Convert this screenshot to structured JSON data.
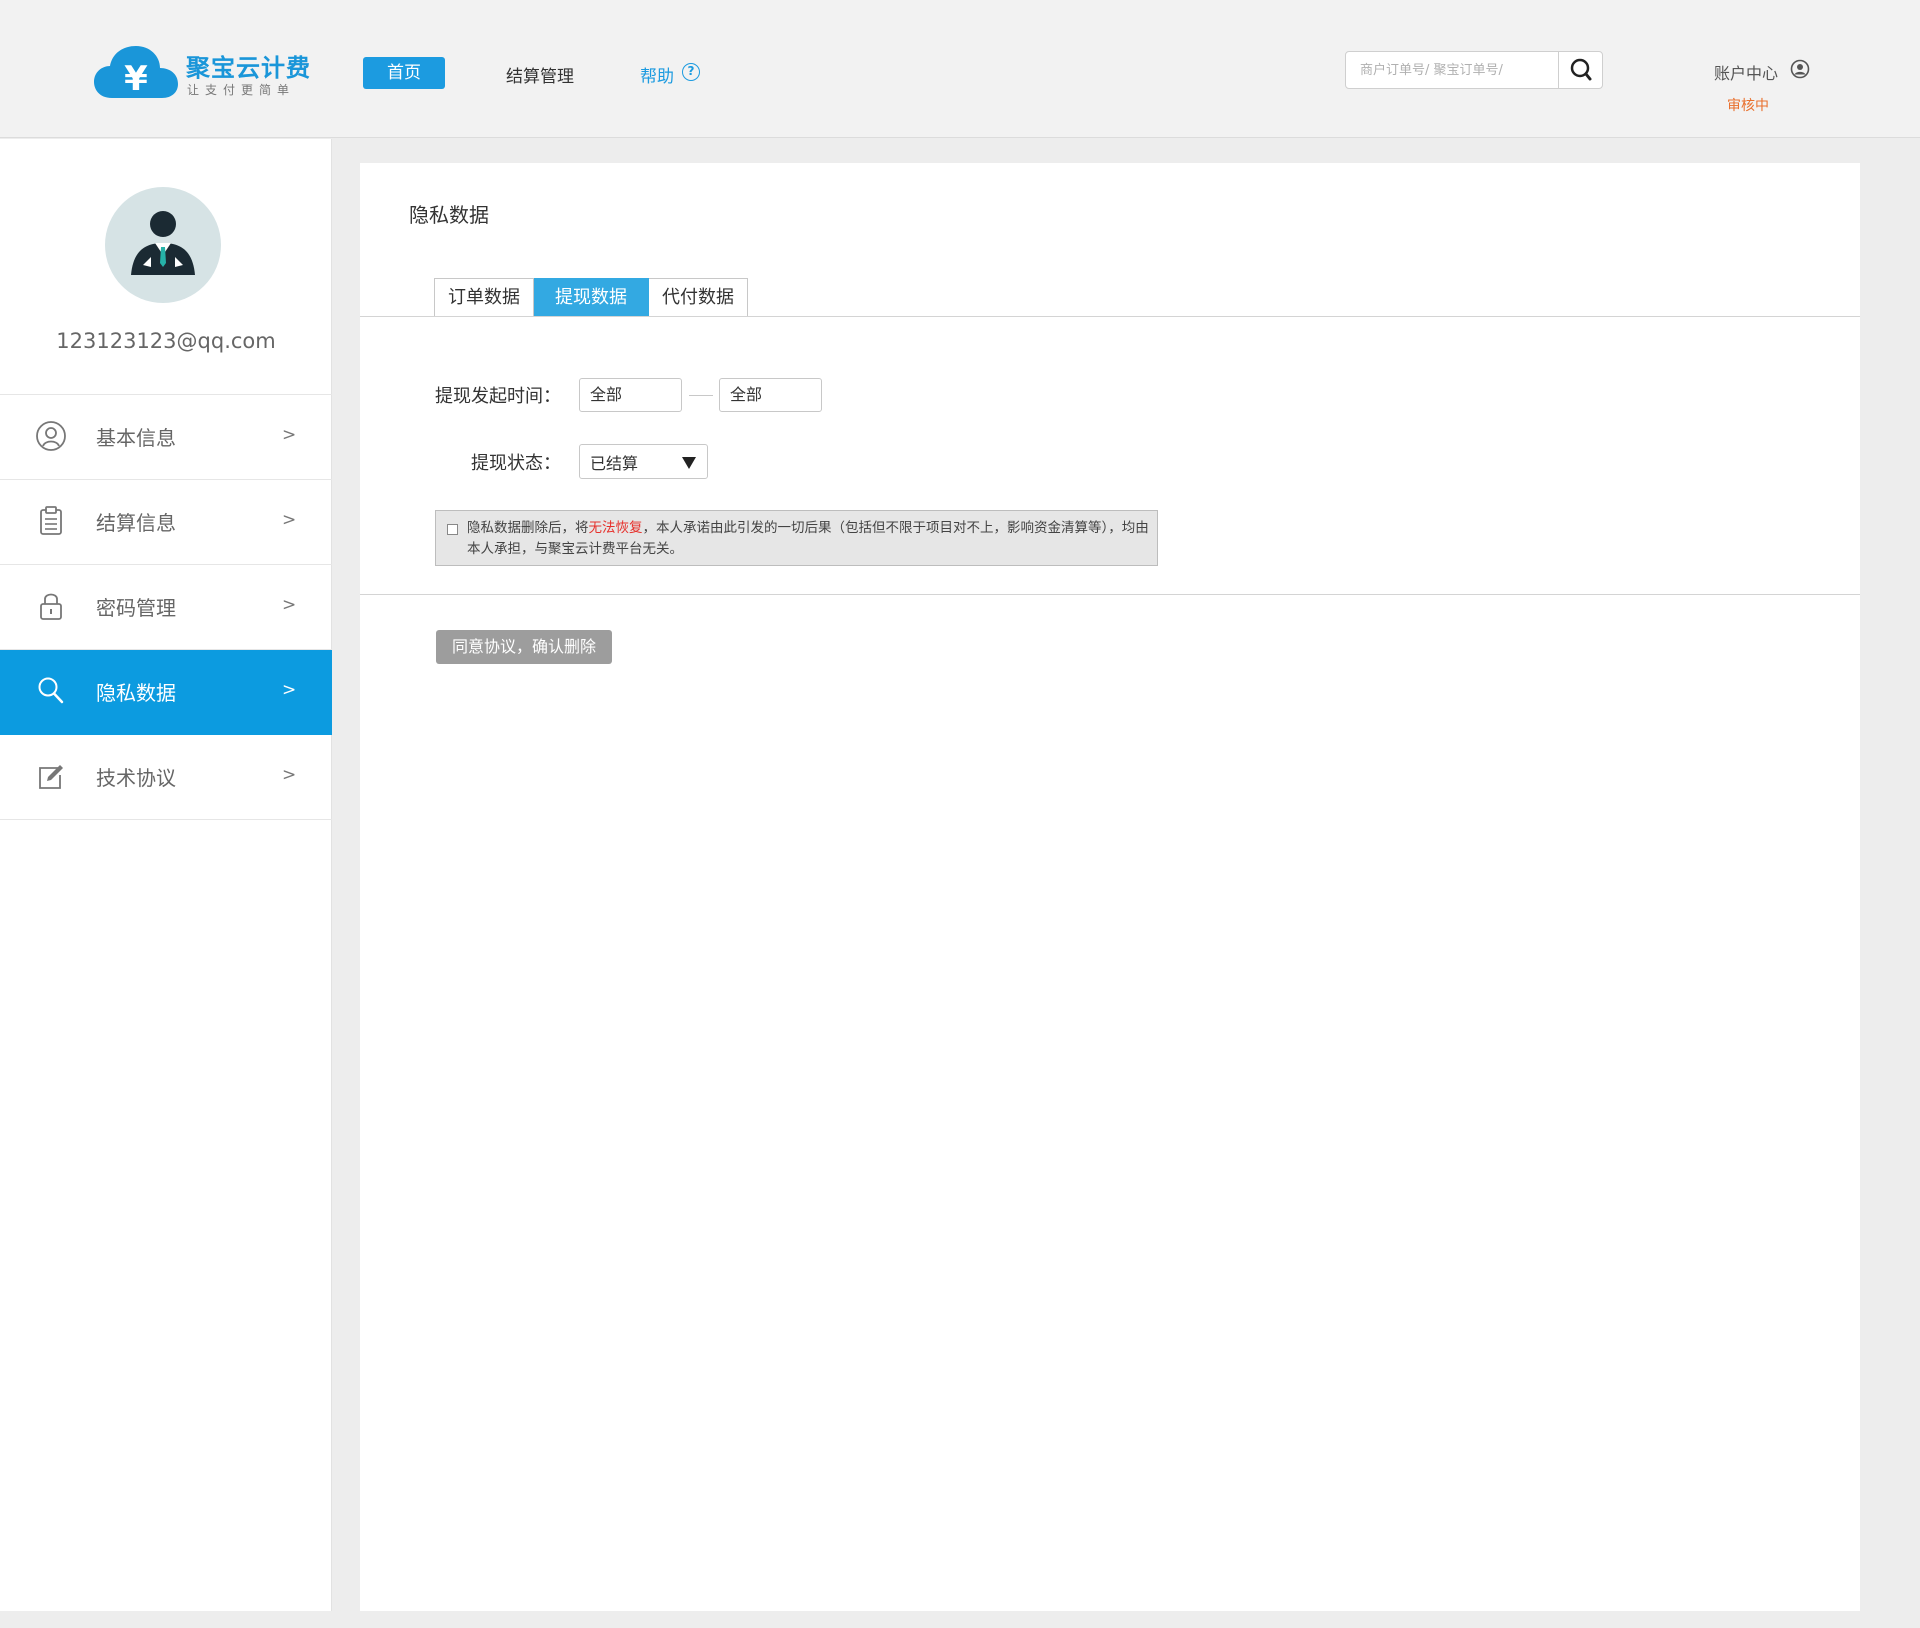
{
  "brand": {
    "name": "聚宝云计费",
    "slogan": "让支付更简单",
    "primary_color": "#1c9be0",
    "icon": "cloud-yen-logo-icon"
  },
  "header": {
    "nav": {
      "home_label": "首页",
      "settlement_label": "结算管理",
      "help_label": "帮助",
      "help_icon": "question-circle-icon"
    },
    "search": {
      "placeholder": "商户订单号/ 聚宝订单号/",
      "value": "",
      "icon": "search-icon"
    },
    "account": {
      "label": "账户中心",
      "icon": "user-circle-icon",
      "status": "审核中",
      "status_color": "#e9702d"
    }
  },
  "sidebar": {
    "email": "123123123@qq.com",
    "avatar_icon": "businessman-avatar-icon",
    "items": [
      {
        "label": "基本信息",
        "icon": "user-outline-icon",
        "arrow": ">",
        "active": false
      },
      {
        "label": "结算信息",
        "icon": "clipboard-icon",
        "arrow": ">",
        "active": false
      },
      {
        "label": "密码管理",
        "icon": "lock-icon",
        "arrow": ">",
        "active": false
      },
      {
        "label": "隐私数据",
        "icon": "search-icon",
        "arrow": ">",
        "active": true
      },
      {
        "label": "技术协议",
        "icon": "edit-icon",
        "arrow": ">",
        "active": false
      }
    ],
    "active_color": "#0c9be0"
  },
  "main": {
    "title": "隐私数据",
    "tabs": [
      {
        "label": "订单数据",
        "active": false
      },
      {
        "label": "提现数据",
        "active": true
      },
      {
        "label": "代付数据",
        "active": false
      }
    ],
    "filters": {
      "time_label": "提现发起时间：",
      "time_from": "全部",
      "time_to": "全部",
      "status_label": "提现状态：",
      "status_value": "已结算"
    },
    "notice": {
      "checked": false,
      "text_before": "隐私数据删除后，将",
      "text_warn": "无法恢复",
      "text_after": "，本人承诺由此引发的一切后果（包括但不限于项目对不上，影响资金清算等），均由本人承担，与聚宝云计费平台无关。",
      "warn_color": "#e6302b"
    },
    "confirm_button": "同意协议，确认删除"
  }
}
